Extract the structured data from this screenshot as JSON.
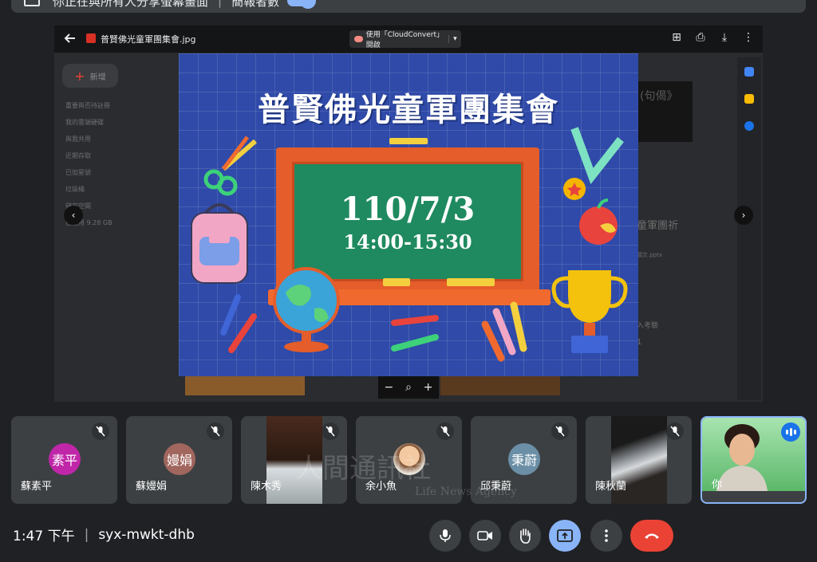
{
  "banner": {
    "text": "你正在與所有人分享螢幕畫面",
    "pin_label": "簡報者數"
  },
  "viewer": {
    "file_name": "普賢佛光童軍團集會.jpg",
    "open_with": "使用「CloudConvert」開啟"
  },
  "drive": {
    "new_label": "新增",
    "sidebar_items": [
      "重要與否待註冊",
      "我的雲端硬碟",
      "與我共用",
      "近期存取",
      "已加星號",
      "垃圾桶",
      "儲存空間"
    ],
    "storage": "已使用 9.28 GB",
    "right_text_1": "(句偈》",
    "right_text_2": "童軍團祈",
    "right_text_3": "願文.pptx",
    "right_text_4": "入考驗",
    "right_text_5": "1"
  },
  "slide": {
    "title": "普賢佛光童軍團集會",
    "date": "110/7/3",
    "time": "14:00-15:30"
  },
  "participants": [
    {
      "name": "蘇素平",
      "initials": "素平",
      "color": "#c026a8",
      "type": "avatar"
    },
    {
      "name": "蘇嫚娟",
      "initials": "嫚娟",
      "color": "#a1665e",
      "type": "avatar"
    },
    {
      "name": "陳木秀",
      "initials": "",
      "color": "#5b3f2d",
      "type": "video"
    },
    {
      "name": "余小魚",
      "initials": "",
      "color": "#f2c9a0",
      "type": "photo"
    },
    {
      "name": "邱秉蔚",
      "initials": "秉蔚",
      "color": "#6b8fa6",
      "type": "avatar"
    },
    {
      "name": "陳秋蘭",
      "initials": "",
      "color": "#2d2a28",
      "type": "video"
    },
    {
      "name": "你",
      "initials": "",
      "color": "#7cc37a",
      "type": "self"
    }
  ],
  "meeting": {
    "time": "1:47 下午",
    "code": "syx-mwkt-dhb"
  },
  "watermark": {
    "line1": "人間通訊社",
    "line2": "Life News Agency"
  },
  "colors": {
    "background": "#202124",
    "tile": "#3c4043",
    "accent": "#8ab4f8",
    "hangup": "#ea4335",
    "slide_bg": "#2f4aa8",
    "board": "#1f8a5f"
  }
}
